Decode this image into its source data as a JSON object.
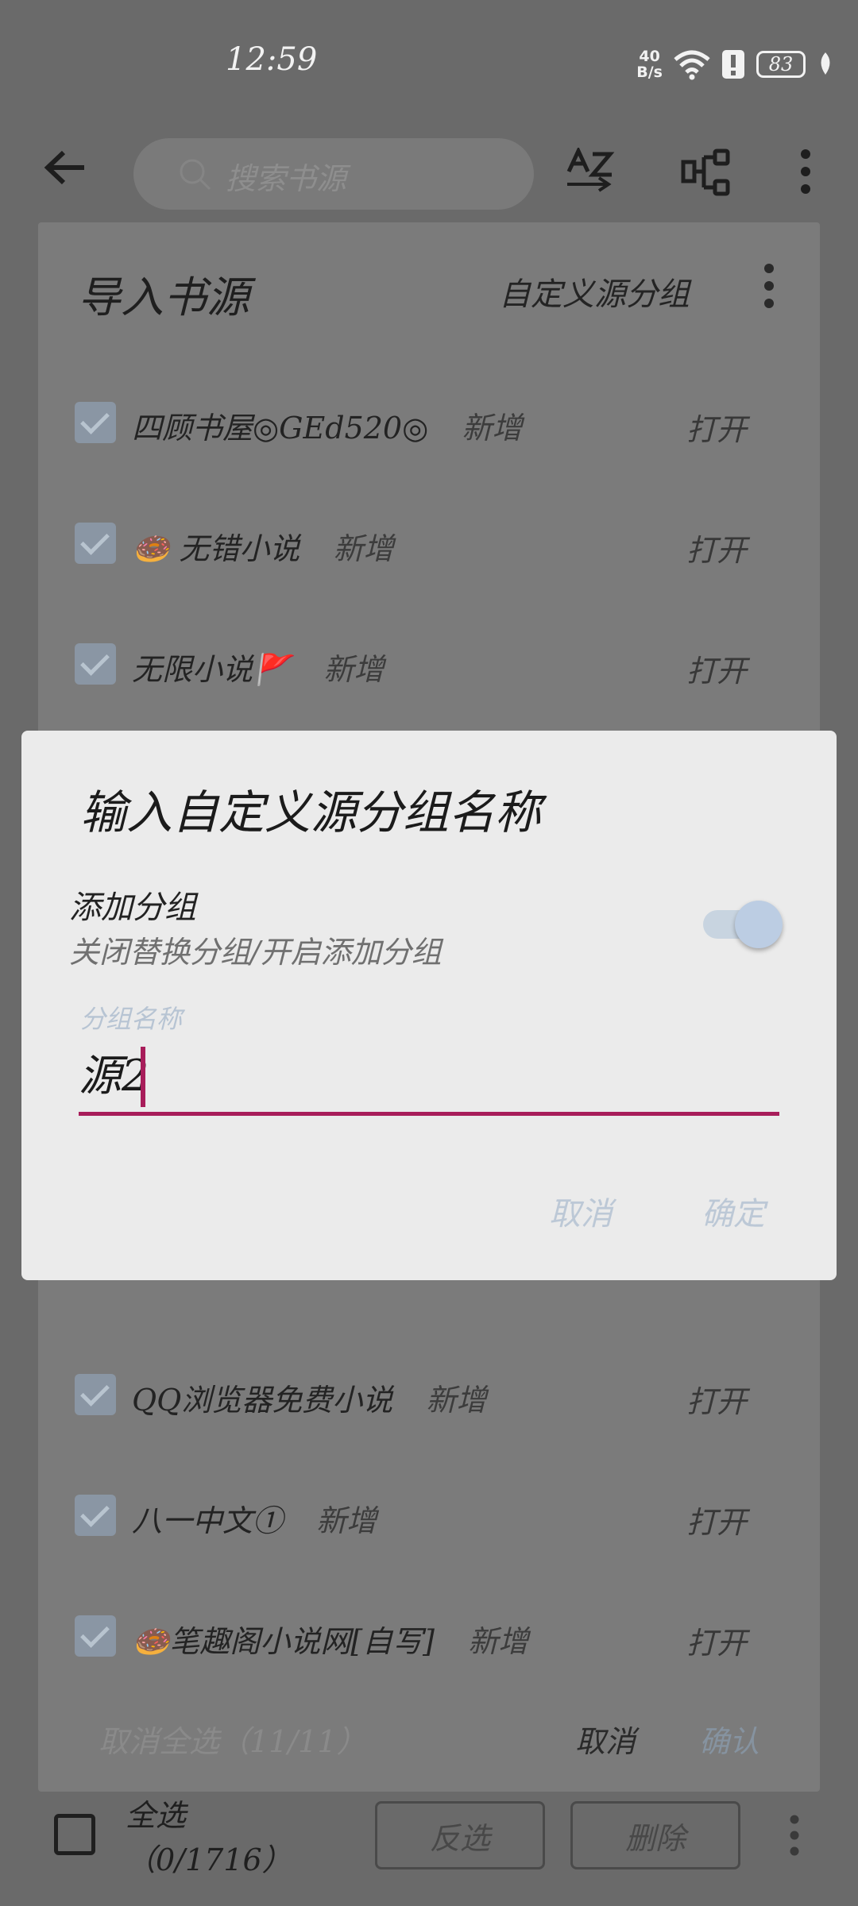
{
  "status_bar": {
    "time": "12:59",
    "net_speed_value": "40",
    "net_speed_unit": "B/s",
    "battery": "83"
  },
  "toolbar": {
    "search_placeholder": "搜索书源"
  },
  "import_sheet": {
    "title": "导入书源",
    "custom_group": "自定义源分组",
    "items": [
      {
        "name": "四顾书屋◎GEd520◎",
        "tag": "新增",
        "action": "打开"
      },
      {
        "name": "🍩 无错小说",
        "tag": "新增",
        "action": "打开"
      },
      {
        "name": "无限小说🚩",
        "tag": "新增",
        "action": "打开"
      },
      {
        "name": "QQ浏览器免费小说",
        "tag": "新增",
        "action": "打开"
      },
      {
        "name": "八一中文①",
        "tag": "新增",
        "action": "打开"
      },
      {
        "name": "🍩笔趣阁小说网[自写]",
        "tag": "新增",
        "action": "打开"
      }
    ],
    "footer": {
      "deselect_all": "取消全选（11/11）",
      "cancel": "取消",
      "confirm": "确认"
    }
  },
  "bottom_bar": {
    "select_all": "全选",
    "count": "（0/1716）",
    "invert": "反选",
    "delete": "删除"
  },
  "dialog": {
    "title": "输入自定义源分组名称",
    "add_group_label": "添加分组",
    "add_group_hint": "关闭替换分组/开启添加分组",
    "switch_on": true,
    "field_label": "分组名称",
    "field_value": "源2",
    "cancel": "取消",
    "confirm": "确定"
  }
}
